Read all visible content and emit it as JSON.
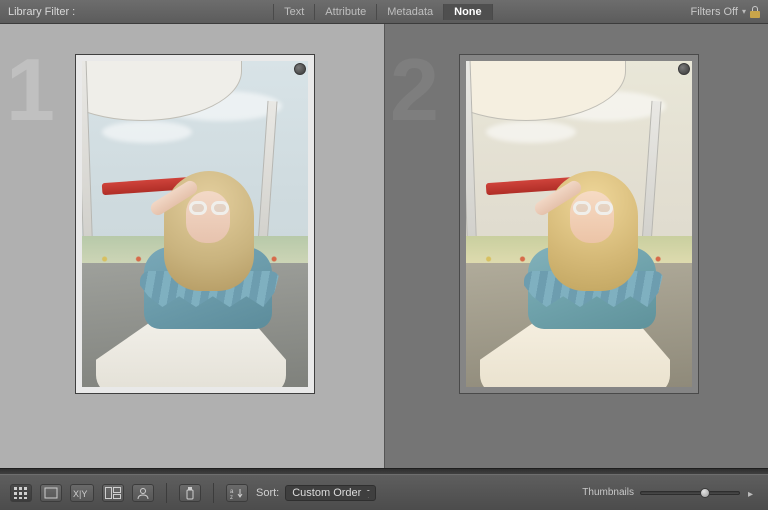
{
  "filter_bar": {
    "label": "Library Filter :",
    "tabs": [
      {
        "label": "Text",
        "selected": false
      },
      {
        "label": "Attribute",
        "selected": false
      },
      {
        "label": "Metadata",
        "selected": false
      },
      {
        "label": "None",
        "selected": true
      }
    ],
    "filters_off_label": "Filters Off"
  },
  "compare": {
    "left_number": "1",
    "right_number": "2"
  },
  "toolbar": {
    "sort_label": "Sort:",
    "sort_value": "Custom Order",
    "thumbnails_label": "Thumbnails",
    "thumbnails_value_pct": 60
  }
}
